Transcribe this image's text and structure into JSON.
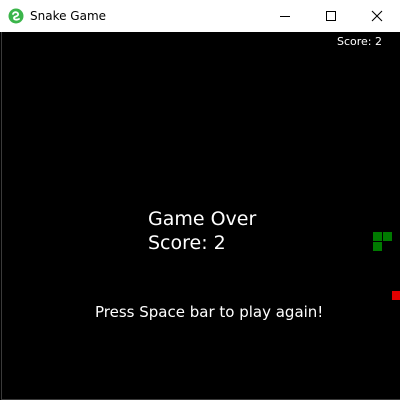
{
  "window": {
    "title": "Snake Game",
    "icon": "snake-app-icon",
    "controls": [
      "minimize-icon",
      "maximize-icon",
      "close-icon"
    ]
  },
  "hud": {
    "score_text": "Score: 2"
  },
  "game_over": {
    "title": "Game Over",
    "score_text": "Score: 2",
    "restart_hint": "Press Space bar to play again!"
  },
  "game": {
    "state": "game-over",
    "score": 2,
    "snake_length": 3,
    "colors": {
      "background": "#000000",
      "snake": "#007a00",
      "food": "#e00000",
      "text": "#ffffff"
    }
  }
}
